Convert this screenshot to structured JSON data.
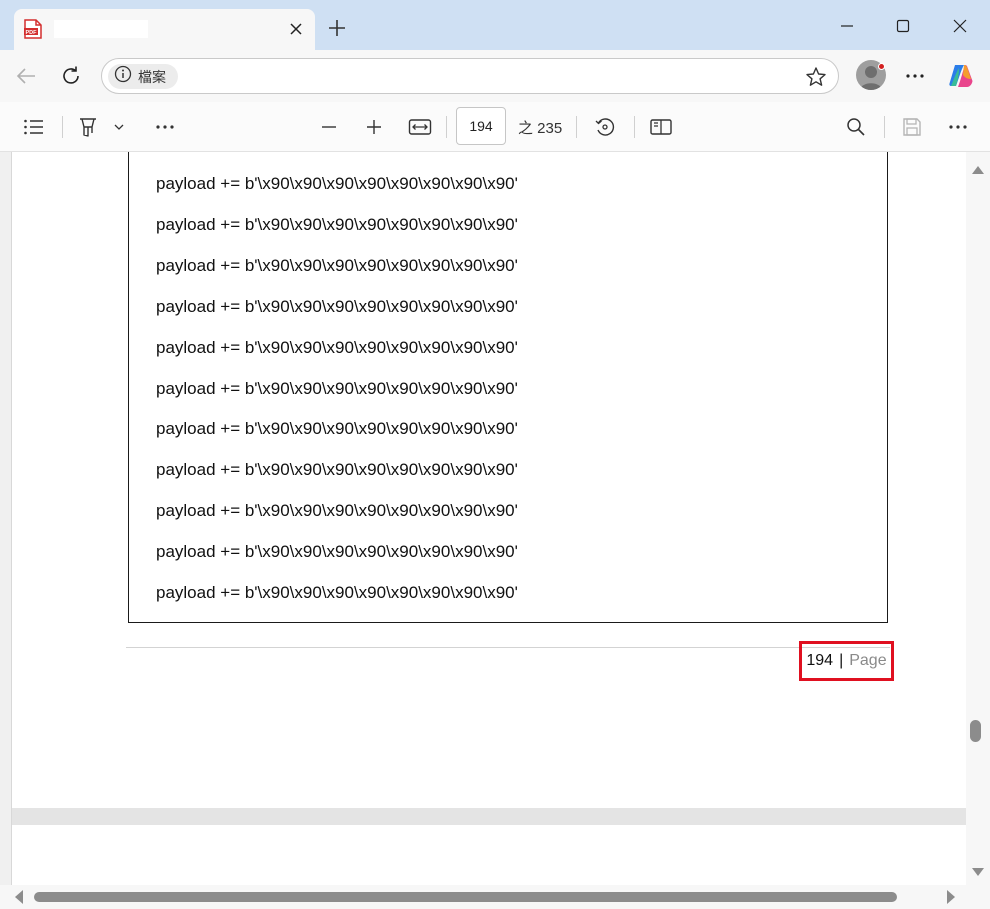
{
  "browser": {
    "tab": {
      "title": "",
      "favicon_label": "PDF"
    },
    "address": {
      "site_chip_label": "檔案",
      "url": ""
    }
  },
  "pdf_toolbar": {
    "current_page": "194",
    "total_pages_label": "之 235"
  },
  "document": {
    "code_lines": [
      "payload += b'\\x90\\x90\\x90\\x90\\x90\\x90\\x90\\x90'",
      "payload += b'\\x90\\x90\\x90\\x90\\x90\\x90\\x90\\x90'",
      "payload += b'\\x90\\x90\\x90\\x90\\x90\\x90\\x90\\x90'",
      "payload += b'\\x90\\x90\\x90\\x90\\x90\\x90\\x90\\x90'",
      "payload += b'\\x90\\x90\\x90\\x90\\x90\\x90\\x90\\x90'",
      "payload += b'\\x90\\x90\\x90\\x90\\x90\\x90\\x90\\x90'",
      "payload += b'\\x90\\x90\\x90\\x90\\x90\\x90\\x90\\x90'",
      "payload += b'\\x90\\x90\\x90\\x90\\x90\\x90\\x90\\x90'",
      "payload += b'\\x90\\x90\\x90\\x90\\x90\\x90\\x90\\x90'",
      "payload += b'\\x90\\x90\\x90\\x90\\x90\\x90\\x90\\x90'",
      "payload += b'\\x90\\x90\\x90\\x90\\x90\\x90\\x90\\x90'"
    ],
    "footer": {
      "page_number": "194",
      "separator": "|",
      "label": "Page"
    }
  },
  "colors": {
    "highlight": "#e01020",
    "tabstrip": "#cfe0f3",
    "pdf_icon": "#d32f2f"
  }
}
